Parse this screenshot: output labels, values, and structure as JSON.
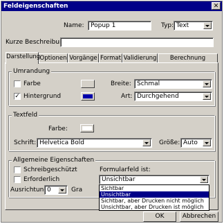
{
  "window": {
    "title": "Feldeigenschaften",
    "close_glyph": "✕"
  },
  "name_label": "Name:",
  "name_value": "Popup 1",
  "typ_label": "Typ:",
  "typ_value": "Text",
  "kurz_label": "Kurze Beschreibung:",
  "kurz_value": "",
  "tabs": [
    {
      "label": "Darstellung",
      "active": true
    },
    {
      "label": "Optionen",
      "active": false
    },
    {
      "label": "Vorgänge",
      "active": false
    },
    {
      "label": "Format",
      "active": false
    },
    {
      "label": "Validierung",
      "active": false
    },
    {
      "label": "Berechnung",
      "active": false
    }
  ],
  "umrandung": {
    "title": "Umrandung",
    "farbe_label": "Farbe",
    "farbe_checked": false,
    "farbe_color": "#d4d0c8",
    "hintergrund_label": "Hintergrund",
    "hintergrund_checked": true,
    "hintergrund_color": "#0000aa",
    "breite_label": "Breite:",
    "breite_value": "Schmal",
    "art_label": "Art:",
    "art_value": "Durchgehend"
  },
  "textfeld": {
    "title": "Textfeld",
    "farbe_label": "Farbe:",
    "farbe_color": "#ffffff",
    "schrift_label": "Schrift:",
    "schrift_value": "Helvetica Bold",
    "groesse_label": "Größe:",
    "groesse_value": "Auto"
  },
  "allgemein": {
    "title": "Allgemeine Eigenschaften",
    "schreib_label": "Schreibgeschützt",
    "erforderlich_label": "Erforderlich",
    "ausrichtung_label": "Ausrichtung:",
    "ausrichtung_value": "0",
    "gra_label": "Gra",
    "formularfeld_label": "Formularfeld ist:",
    "formularfeld_value": "Unsichtbar",
    "options": [
      {
        "label": "Sichtbar",
        "selected": false
      },
      {
        "label": "Unsichtbar",
        "selected": true
      },
      {
        "label": "Sichtbar, aber Drucken nicht möglich",
        "selected": false
      },
      {
        "label": "Unsichtbar, aber Drucken ist möglich",
        "selected": false
      }
    ]
  },
  "buttons": {
    "ok": "OK",
    "abbrechen": "Abbrechen"
  }
}
